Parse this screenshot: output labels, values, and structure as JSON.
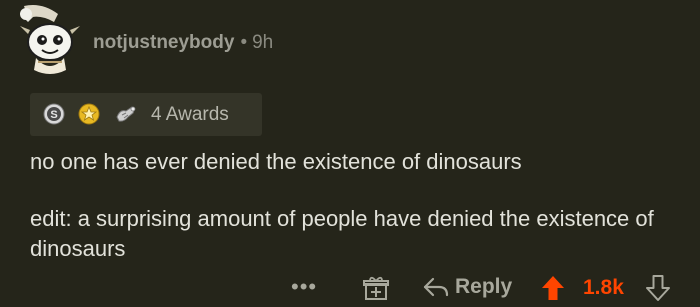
{
  "comment": {
    "username": "notjustneybody",
    "separator": "•",
    "time_ago": "9h",
    "awards": {
      "label": "4 Awards",
      "icons": [
        "silver-award-icon",
        "gold-award-icon",
        "wholesome-award-icon"
      ]
    },
    "body": [
      "no one has ever denied the existence of dinosaurs",
      "edit: a surprising amount of people have denied the existence of dinosaurs"
    ],
    "actions": {
      "more": "•••",
      "reply_label": "Reply",
      "score": "1.8k"
    }
  },
  "colors": {
    "background": "#25251a",
    "upvote": "#ff4500",
    "muted": "#a8a89c"
  }
}
